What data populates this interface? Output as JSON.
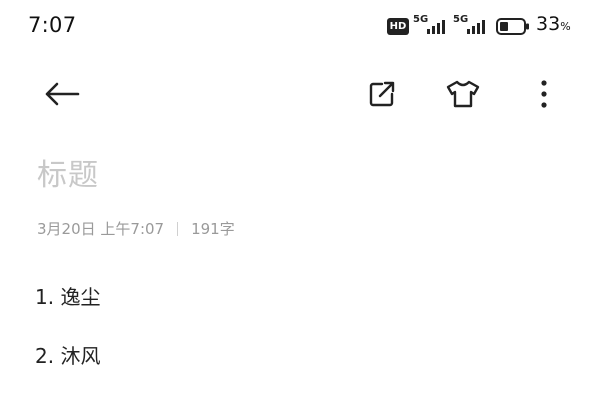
{
  "status_bar": {
    "time": "7:07",
    "hd_label": "HD",
    "signal1_label": "5G",
    "signal2_label": "5G",
    "battery_percent": "33",
    "battery_unit": "%"
  },
  "toolbar": {
    "back_icon": "arrow-left-icon",
    "share_icon": "share-external-icon",
    "theme_icon": "tshirt-icon",
    "more_icon": "more-vertical-icon"
  },
  "note": {
    "title_placeholder": "标题",
    "date": "3月20日 上午7:07",
    "char_count": "191字",
    "lines": [
      "1. 逸尘",
      "2. 沐风"
    ]
  },
  "colors": {
    "background": "#ffffff",
    "text": "#222222",
    "placeholder": "#c8c8c8",
    "meta": "#9a9a9a"
  }
}
